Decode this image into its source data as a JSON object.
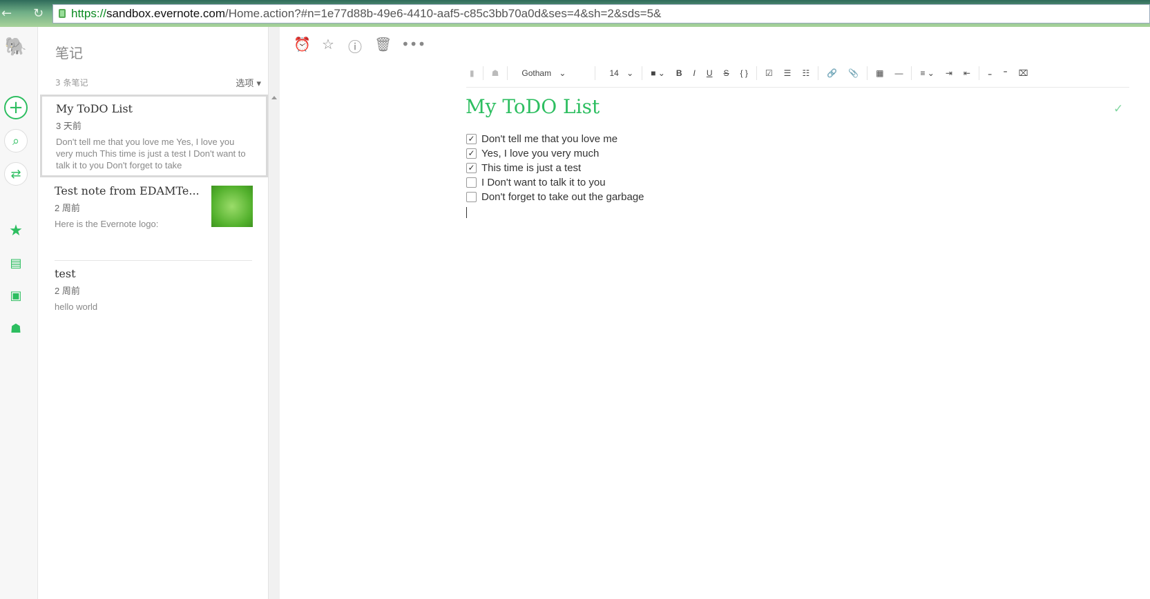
{
  "browser": {
    "url_proto": "https://",
    "url_host": "sandbox.evernote.com",
    "url_path": "/Home.action?#n=1e77d88b-49e6-4410-aaf5-c85c3bb70a0d&ses=4&sh=2&sds=5&"
  },
  "notelist": {
    "title": "笔记",
    "count": "3 条笔记",
    "options": "选项",
    "notes": [
      {
        "title": "My ToDO List",
        "date": "3 天前",
        "snippet": "Don't tell me that you love me Yes, I love you very much This time is just a test I Don't want to talk it to you Don't forget to take"
      },
      {
        "title": "Test note from EDAMTe...",
        "date": "2 周前",
        "snippet": "Here is the Evernote logo:"
      },
      {
        "title": "test",
        "date": "2 周前",
        "snippet": "hello world"
      }
    ]
  },
  "toolbar": {
    "font": "Gotham",
    "size": "14",
    "bold": "B",
    "italic": "I",
    "underline": "U",
    "strike": "S",
    "code": "{ }"
  },
  "note": {
    "title": "My ToDO List",
    "todos": [
      {
        "text": "Don't tell me that you love me",
        "checked": true
      },
      {
        "text": "Yes, I love you very much",
        "checked": true
      },
      {
        "text": "This time is just a test",
        "checked": true
      },
      {
        "text": "I Don't want to talk it to you",
        "checked": false
      },
      {
        "text": "Don't forget to take out the garbage",
        "checked": false
      }
    ]
  },
  "colors": {
    "accent": "#2dbe60"
  }
}
